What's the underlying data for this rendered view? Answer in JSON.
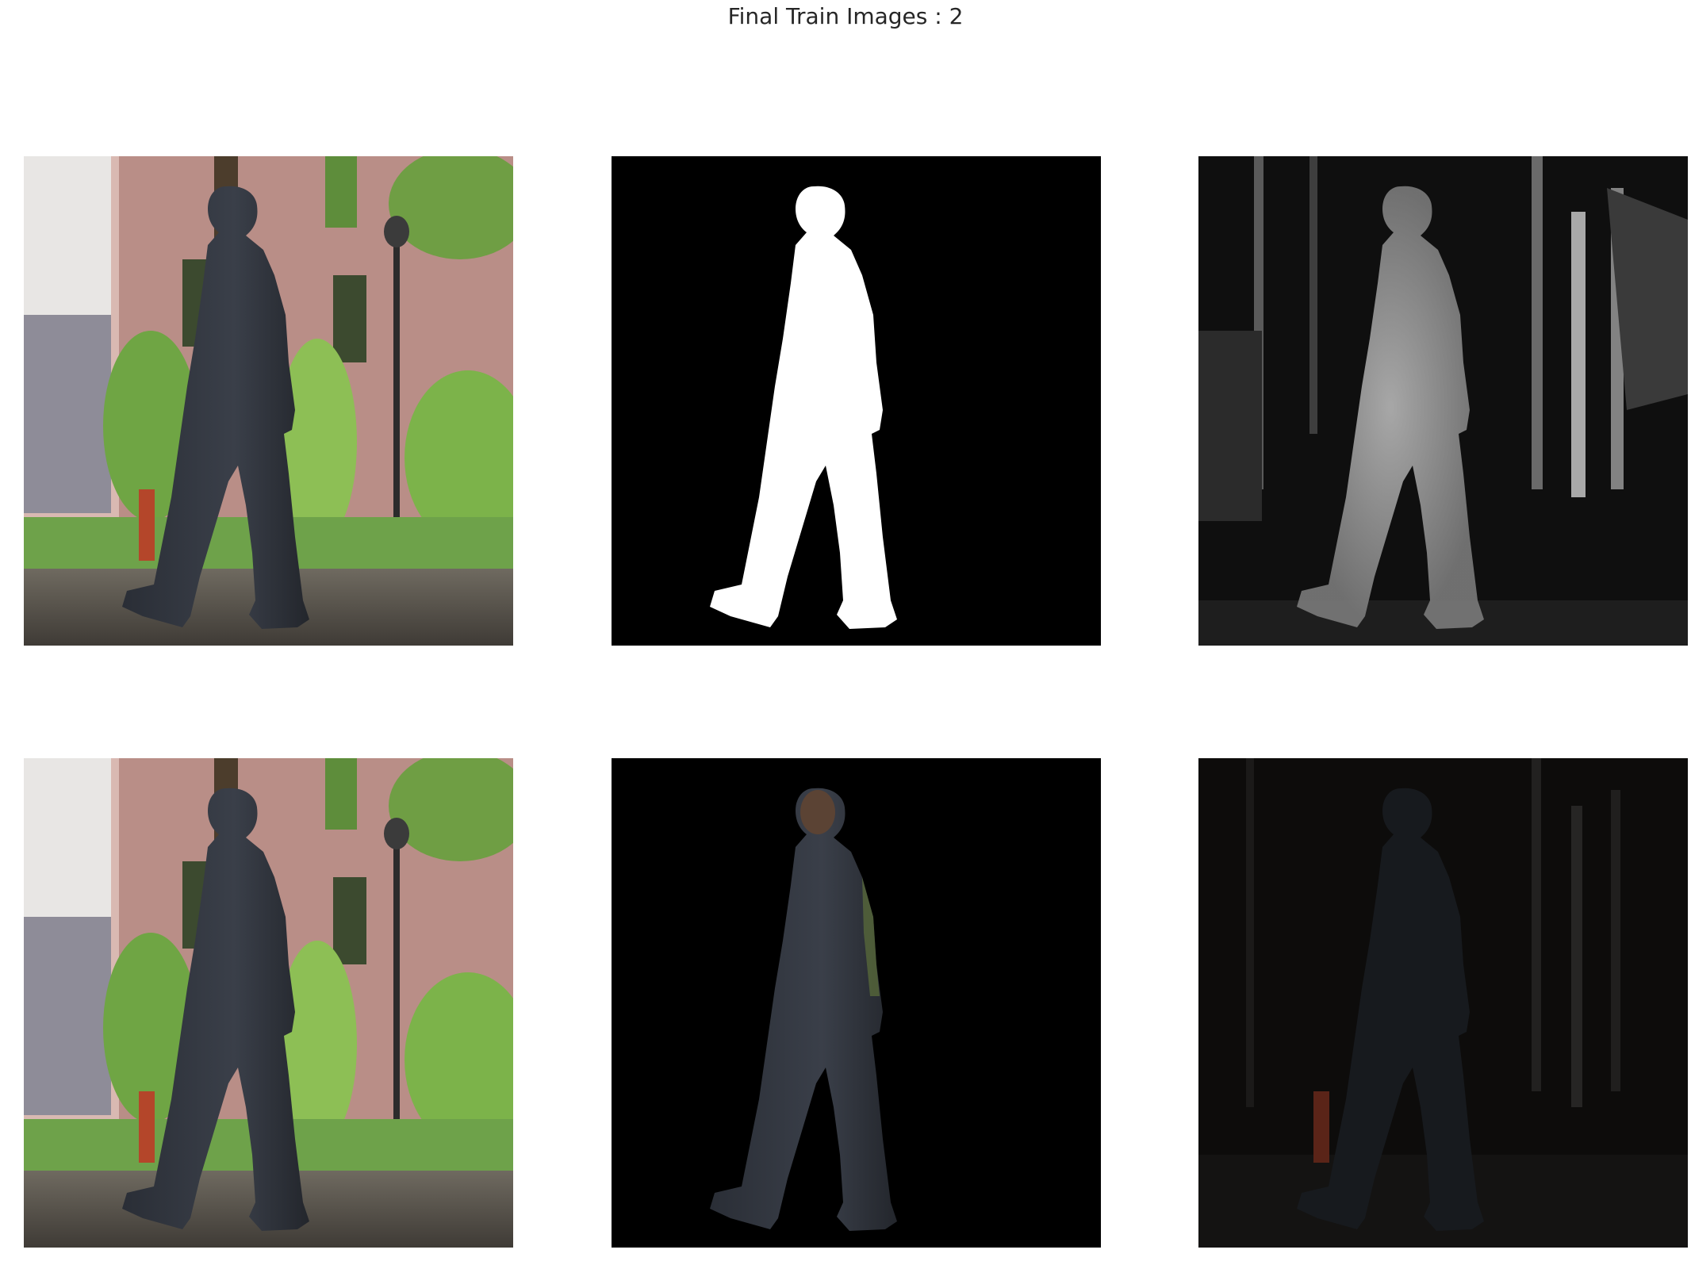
{
  "figure": {
    "suptitle": "Final Train Images : 2"
  },
  "panels": [
    {
      "name": "input-frame-top",
      "kind": "color-photo"
    },
    {
      "name": "ground-truth-mask",
      "kind": "binary-mask"
    },
    {
      "name": "predicted-grayscale-map",
      "kind": "grayscale-map"
    },
    {
      "name": "input-frame-bottom",
      "kind": "color-photo"
    },
    {
      "name": "masked-foreground",
      "kind": "masked-photo"
    },
    {
      "name": "dark-residual-map",
      "kind": "dark-photo"
    }
  ]
}
